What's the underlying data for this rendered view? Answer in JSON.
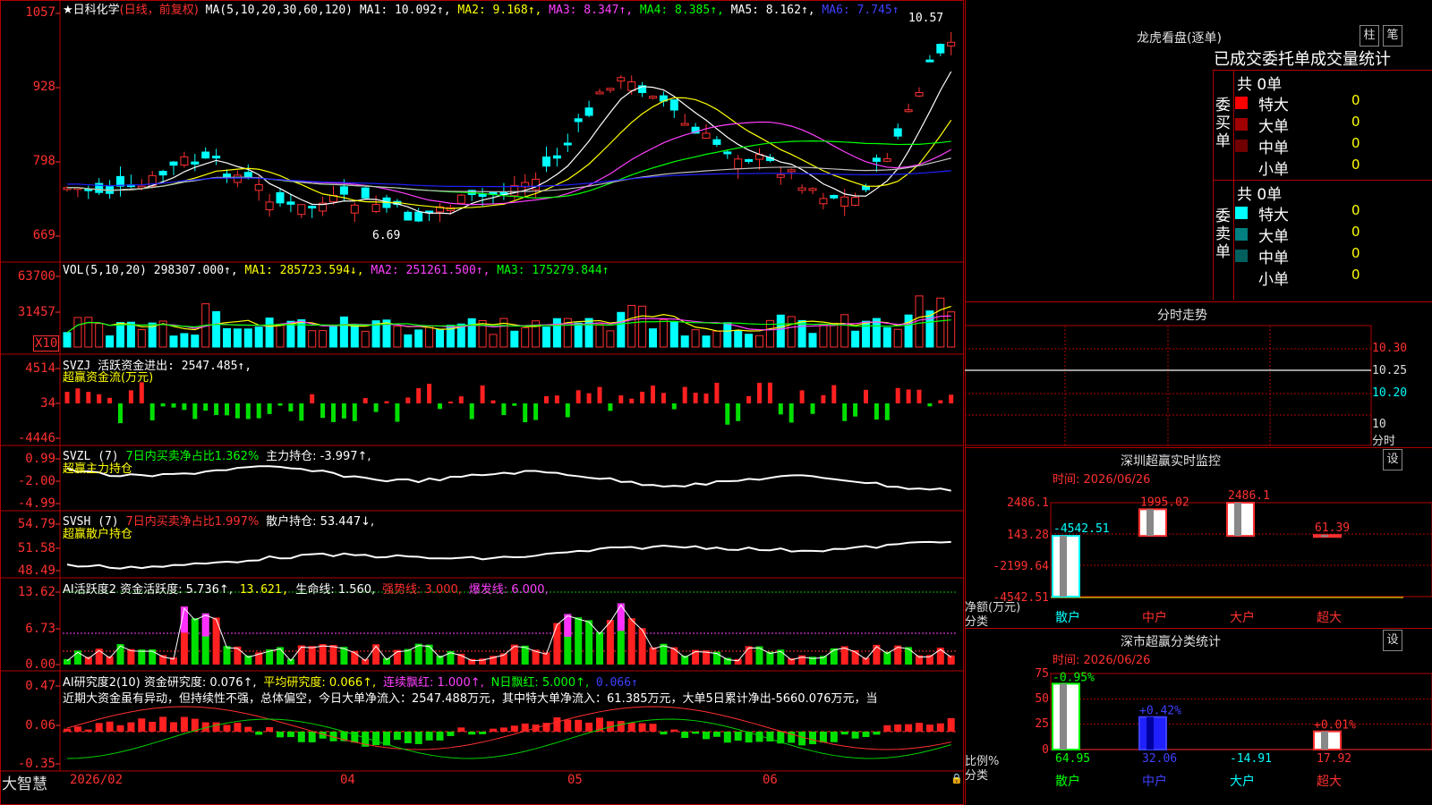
{
  "stock": {
    "title": "★日科化学",
    "mode": "(日线，前复权)",
    "ma_label": "MA(5,10,20,30,60,120)",
    "ma1": "MA1: 10.092↑,",
    "ma2": "MA2: 9.168↑,",
    "ma3": "MA3: 8.347↑,",
    "ma4": "MA4: 8.385↑,",
    "ma5": "MA5: 8.162↑,",
    "ma6": "MA6: 7.745↑",
    "price_axis": [
      "1057",
      "928",
      "798",
      "669"
    ],
    "high_mark": "10.57",
    "low_mark": "6.69"
  },
  "vol": {
    "label": "VOL(5,10,20)",
    "value": "298307.000↑,",
    "ma1": "MA1: 285723.594↓,",
    "ma2": "MA2: 251261.500↑,",
    "ma3": "MA3: 175279.844↑",
    "axis": [
      "63700",
      "31457",
      "X10"
    ]
  },
  "svzj": {
    "label": "SVZJ  活跃资金进出: 2547.485↑,",
    "sub": "超赢资金流(万元)",
    "axis": [
      "4514",
      "34",
      "-4446"
    ]
  },
  "svzl": {
    "label": "SVZL (7)",
    "ratio": "7日内买卖净占比1.362%",
    "hold": "主力持仓: -3.997↑,",
    "sub": "超赢主力持仓",
    "axis": [
      "0.99",
      "-2.00",
      "-4.99"
    ]
  },
  "svsh": {
    "label": "SVSH (7)",
    "ratio": "7日内买卖净占比1.997%",
    "hold": "散户持仓: 53.447↓,",
    "sub": "超赢散户持仓",
    "axis": [
      "54.79",
      "51.58",
      "48.49"
    ]
  },
  "ai1": {
    "label": "AI活跃度2 资金活跃度: 5.736↑,",
    "v2": "13.621,",
    "life": "生命线: 1.560,",
    "strong": "强势线: 3.000,",
    "burst": "爆发线: 6.000,",
    "axis": [
      "13.62",
      "6.73",
      "0.00"
    ]
  },
  "ai2": {
    "label": "AI研究度2(10) 资金研究度: 0.076↑,",
    "avg": "平均研究度: 0.066↑,",
    "cont": "连续飘红: 1.000↑,",
    "nday": "N日飘红: 5.000↑,",
    "last": "0.066↑",
    "commentary": "近期大资金虽有异动，但持续性不强，总体偏空，今日大单净流入：2547.488万元，其中特大单净流入：61.385万元，大单5日累计净出-5660.076万元，当",
    "axis": [
      "0.47",
      "0.06",
      "-0.35"
    ]
  },
  "xaxis": {
    "brand": "大智慧",
    "labels": [
      "2026/02",
      "04",
      "05",
      "06"
    ]
  },
  "right": {
    "lhb_title": "龙虎看盘(逐单)",
    "btn_zhu": "柱",
    "btn_bi": "笔",
    "stat_title": "已成交委托单成交量统计",
    "buy_side": "委买单",
    "sell_side": "委卖单",
    "buy_total": "共 0单",
    "sell_total": "共 0单",
    "buy_rows": [
      {
        "label": "特大",
        "value": "0",
        "color": "#ff0000"
      },
      {
        "label": "大单",
        "value": "0",
        "color": "#a00000"
      },
      {
        "label": "中单",
        "value": "0",
        "color": "#700000"
      },
      {
        "label": "小单",
        "value": "0",
        "color": "#000000"
      }
    ],
    "sell_rows": [
      {
        "label": "特大",
        "value": "0",
        "color": "#00ffff"
      },
      {
        "label": "大单",
        "value": "0",
        "color": "#008080"
      },
      {
        "label": "中单",
        "value": "0",
        "color": "#006060"
      },
      {
        "label": "小单",
        "value": "0",
        "color": "#000000"
      }
    ],
    "fenshi_title": "分时走势",
    "fenshi_axis": [
      "10.30",
      "10.25",
      "10.20",
      "10"
    ],
    "fenshi_unit": "分时",
    "sz_title": "深圳超赢实时监控",
    "sz_btn": "设",
    "sz_time": "时间: 2026/06/26",
    "sz_axis": [
      "2486.1",
      "143.28",
      "-2199.64",
      "-4542.51"
    ],
    "sz_ylabel": "净额(万元)",
    "sz_xlabel": "分类",
    "sz_bars": [
      {
        "cat": "散户",
        "value": -4542.51,
        "label": "-4542.51"
      },
      {
        "cat": "中户",
        "value": 1995.02,
        "label": "1995.02"
      },
      {
        "cat": "大户",
        "value": 2486.1,
        "label": "2486.1"
      },
      {
        "cat": "超大",
        "value": 61.39,
        "label": "61.39"
      }
    ],
    "ss_title": "深市超赢分类统计",
    "ss_btn": "设",
    "ss_time": "时间: 2026/06/26",
    "ss_axis": [
      "75",
      "50",
      "25",
      "0"
    ],
    "ss_ylabel": "比例%",
    "ss_xlabel": "分类",
    "ss_bars": [
      {
        "cat": "散户",
        "value": 64.95,
        "top": "-0.95%",
        "bottom": "64.95"
      },
      {
        "cat": "中户",
        "value": 32.06,
        "top": "+0.42%",
        "bottom": "32.06"
      },
      {
        "cat": "大户",
        "value": -14.91,
        "top": "",
        "bottom": "-14.91"
      },
      {
        "cat": "超大",
        "value": 17.92,
        "top": "+0.01%",
        "bottom": "17.92"
      }
    ]
  },
  "colors": {
    "up": "#ff3030",
    "down": "#00ffff",
    "grid": "#b00000"
  }
}
